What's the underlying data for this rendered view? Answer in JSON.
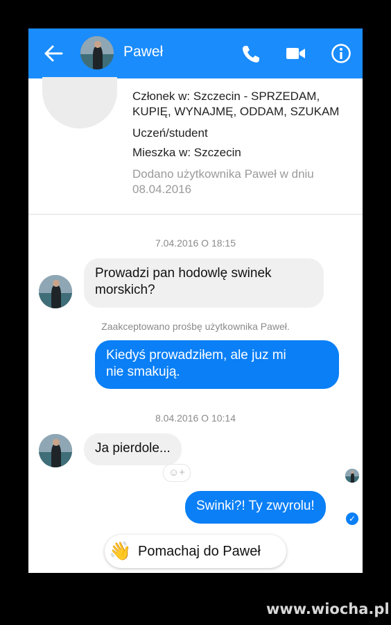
{
  "header": {
    "contact_name": "Paweł",
    "icons": [
      "back-arrow-icon",
      "phone-icon",
      "video-camera-icon",
      "info-icon"
    ],
    "color": "#1a8cfc"
  },
  "profile": {
    "member": "Członek w: Szczecin - SPRZEDAM, KUPIĘ, WYNAJMĘ, ODDAM, SZUKAM",
    "member_line1": "Członek w: Szczecin - SPRZEDAM,",
    "member_line2": "KUPIĘ, WYNAJMĘ, ODDAM, SZUKAM",
    "occupation": "Uczeń/student",
    "location": "Mieszka w: Szczecin",
    "added_line1": "Dodano użytkownika Paweł w dniu",
    "added_line2": "08.04.2016"
  },
  "messages": [
    {
      "type": "timestamp",
      "text": "7.04.2016 O 18:15"
    },
    {
      "type": "incoming",
      "line1": "Prowadzi pan hodowlę swinek",
      "line2": "morskich?"
    },
    {
      "type": "system",
      "text": "Zaakceptowano prośbę użytkownika Paweł."
    },
    {
      "type": "outgoing",
      "line1": "Kiedyś prowadziłem, ale juz mi",
      "line2": "nie smakują."
    },
    {
      "type": "timestamp",
      "text": "8.04.2016 O 10:14"
    },
    {
      "type": "incoming",
      "text": "Ja pierdole..."
    },
    {
      "type": "outgoing",
      "text": "Swinki?! Ty zwyrolu!"
    }
  ],
  "reaction_button": "☺+",
  "seen_check": "✓",
  "wave_button": {
    "emoji": "👋",
    "label": "Pomachaj do Paweł"
  },
  "watermark": "www.wiocha.pl",
  "colors": {
    "outgoing_bubble": "#0a7ff6",
    "incoming_bubble": "#f0f0f0"
  }
}
